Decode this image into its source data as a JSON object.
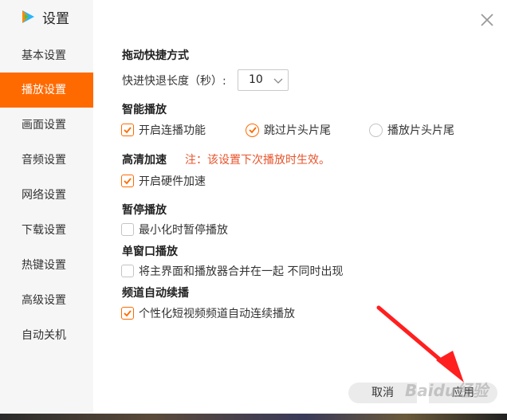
{
  "app": {
    "title": "设置",
    "logo_icon": "play-logo-icon"
  },
  "sidebar": {
    "items": [
      {
        "label": "基本设置",
        "active": false
      },
      {
        "label": "播放设置",
        "active": true
      },
      {
        "label": "画面设置",
        "active": false
      },
      {
        "label": "音频设置",
        "active": false
      },
      {
        "label": "网络设置",
        "active": false
      },
      {
        "label": "下载设置",
        "active": false
      },
      {
        "label": "热键设置",
        "active": false
      },
      {
        "label": "高级设置",
        "active": false
      },
      {
        "label": "自动关机",
        "active": false
      }
    ]
  },
  "colors": {
    "accent": "#ff6a00",
    "note": "#e8542c",
    "sidebar_bg": "#f6f6f6"
  },
  "sections": {
    "drag": {
      "title": "拖动快捷方式",
      "step_label": "快进快退长度（秒）:",
      "step_value": "10"
    },
    "smart": {
      "title": "智能播放",
      "options": [
        {
          "label": "开启连播功能",
          "type": "checkbox",
          "checked": true
        },
        {
          "label": "跳过片头片尾",
          "type": "radio",
          "checked": true
        },
        {
          "label": "播放片头片尾",
          "type": "radio",
          "checked": false
        }
      ]
    },
    "hd": {
      "title": "高清加速",
      "note": "注：该设置下次播放时生效。",
      "options": [
        {
          "label": "开启硬件加速",
          "type": "checkbox",
          "checked": true
        }
      ]
    },
    "pause": {
      "title": "暂停播放",
      "options": [
        {
          "label": "最小化时暂停播放",
          "type": "checkbox",
          "checked": false
        }
      ]
    },
    "single": {
      "title": "单窗口播放",
      "options": [
        {
          "label": "将主界面和播放器合并在一起 不同时出现",
          "type": "checkbox",
          "checked": false
        }
      ]
    },
    "channel": {
      "title": "频道自动续播",
      "options": [
        {
          "label": "个性化短视频频道自动连续播放",
          "type": "checkbox",
          "checked": true
        }
      ]
    }
  },
  "footer": {
    "cancel_label": "取消",
    "apply_label": "应用"
  },
  "watermark": "Baidu经验"
}
